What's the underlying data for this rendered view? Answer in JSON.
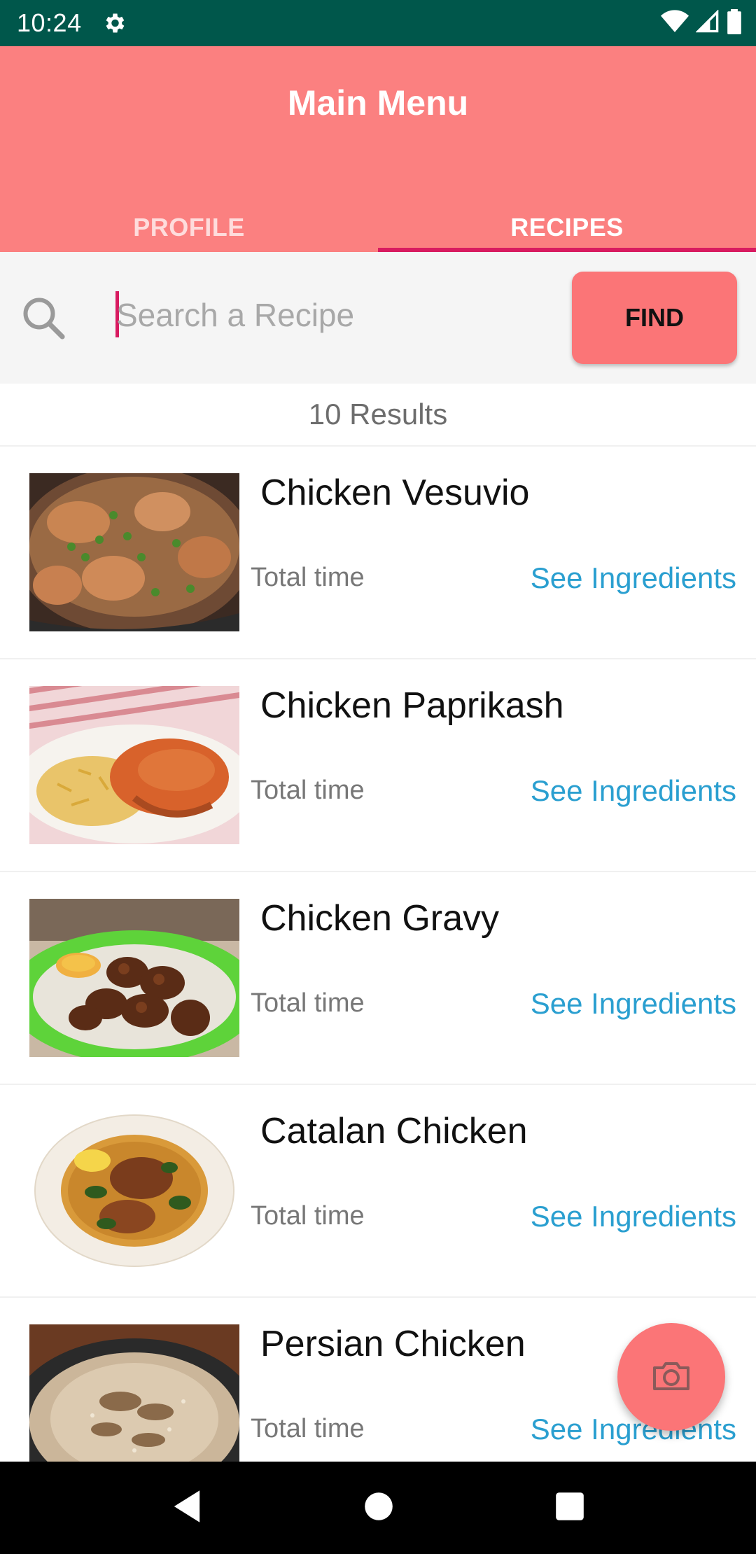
{
  "status_bar": {
    "time": "10:24"
  },
  "header": {
    "title": "Main Menu",
    "tabs": [
      {
        "label": "PROFILE",
        "active": false
      },
      {
        "label": "RECIPES",
        "active": true
      }
    ]
  },
  "search": {
    "placeholder": "Search a Recipe",
    "value": "",
    "find_label": "FIND"
  },
  "results": {
    "count_label": "10 Results"
  },
  "recipes": [
    {
      "title": "Chicken Vesuvio",
      "time_label": "Total time",
      "link_label": "See Ingredients"
    },
    {
      "title": "Chicken Paprikash",
      "time_label": "Total time",
      "link_label": "See Ingredients"
    },
    {
      "title": "Chicken Gravy",
      "time_label": "Total time",
      "link_label": "See Ingredients"
    },
    {
      "title": "Catalan Chicken",
      "time_label": "Total time",
      "link_label": "See Ingredients"
    },
    {
      "title": "Persian Chicken",
      "time_label": "Total time",
      "link_label": "See Ingredients"
    }
  ],
  "colors": {
    "status_bar": "#00574b",
    "header": "#fb8080",
    "accent": "#d81b60",
    "button": "#fb7577",
    "link": "#2a9fd0"
  },
  "icons": [
    "gear-icon",
    "wifi-icon",
    "signal-icon",
    "battery-icon",
    "search-icon",
    "camera-icon",
    "back-icon",
    "home-icon",
    "recents-icon"
  ]
}
